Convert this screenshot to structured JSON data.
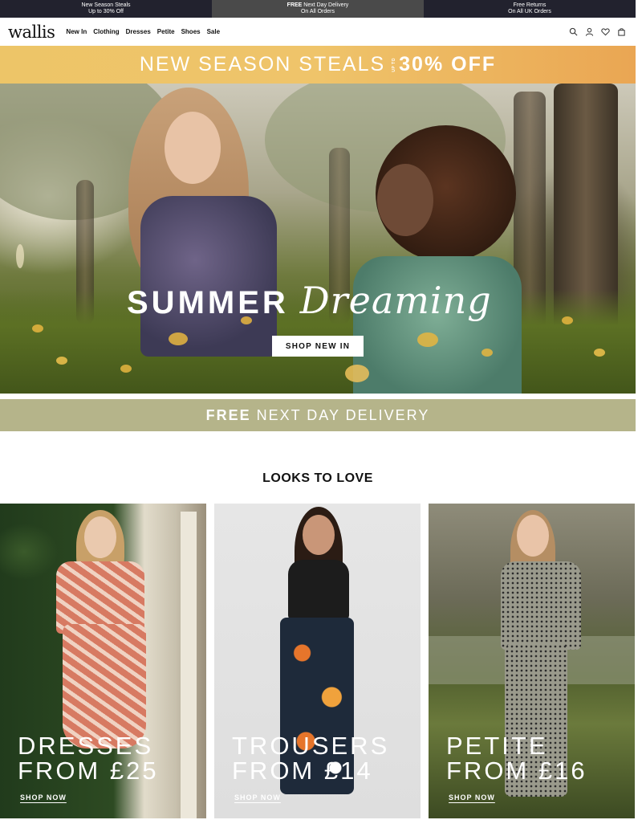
{
  "promo": [
    {
      "line1": "New Season Steals",
      "line2": "Up to 30% Off",
      "bold1": false
    },
    {
      "line1_bold": "FREE",
      "line1_rest": " Next Day Delivery",
      "line2": "On All Orders"
    },
    {
      "line1": "Free Returns",
      "line2": "On All UK Orders"
    }
  ],
  "header": {
    "logo": "wallis",
    "nav": [
      "New In",
      "Clothing",
      "Dresses",
      "Petite",
      "Shoes",
      "Sale"
    ],
    "icons": [
      "search-icon",
      "account-icon",
      "wishlist-icon",
      "bag-icon"
    ]
  },
  "season_banner": {
    "text": "NEW SEASON STEALS",
    "upto": "UP TO",
    "offer": "30% OFF"
  },
  "hero": {
    "title_block": "SUMMER",
    "title_script": "Dreaming",
    "button": "SHOP NEW IN"
  },
  "delivery": {
    "bold": "FREE",
    "rest": "NEXT DAY DELIVERY"
  },
  "looks": {
    "title": "LOOKS TO LOVE",
    "cards": [
      {
        "line1": "DRESSES",
        "line2": "FROM £25",
        "cta": "SHOP NOW"
      },
      {
        "line1": "TROUSERS",
        "line2": "FROM £14",
        "cta": "SHOP NOW"
      },
      {
        "line1": "PETITE",
        "line2": "FROM £16",
        "cta": "SHOP NOW"
      }
    ]
  },
  "colors": {
    "promo_bg": "#22222e",
    "season_gold": "#edc568",
    "delivery_olive": "#b5b48a"
  }
}
